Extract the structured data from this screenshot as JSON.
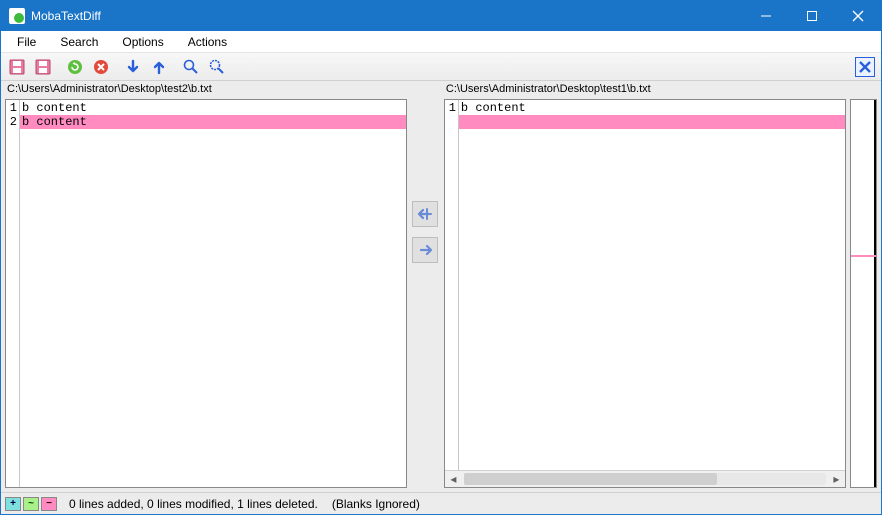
{
  "window": {
    "title": "MobaTextDiff"
  },
  "menu": {
    "file": "File",
    "search": "Search",
    "options": "Options",
    "actions": "Actions"
  },
  "toolbar_icons": {
    "save_left": "save-left-icon",
    "save_right": "save-right-icon",
    "reload": "reload-icon",
    "cancel": "cancel-icon",
    "next_diff": "arrow-down-icon",
    "prev_diff": "arrow-up-icon",
    "zoom": "zoom-icon",
    "zoom_reset": "zoom-reset-icon",
    "close_panel": "close-panel-icon"
  },
  "colors": {
    "titlebar": "#1a74c7",
    "deleted_bg": "#ff8bc0",
    "added_bg": "#7fe0e0",
    "modified_bg": "#a8f08a"
  },
  "left": {
    "path": "C:\\Users\\Administrator\\Desktop\\test2\\b.txt",
    "lines": [
      {
        "num": "1",
        "text": "b content",
        "kind": "same"
      },
      {
        "num": "2",
        "text": "b content",
        "kind": "deleted"
      }
    ]
  },
  "right": {
    "path": "C:\\Users\\Administrator\\Desktop\\test1\\b.txt",
    "lines": [
      {
        "num": "1",
        "text": "b content",
        "kind": "same"
      },
      {
        "num": "",
        "text": "",
        "kind": "deleted"
      }
    ]
  },
  "overview": {
    "markers": [
      {
        "top_pct": 40,
        "color": "#ff8bc0"
      }
    ]
  },
  "status": {
    "add_glyph": "+",
    "mod_glyph": "~",
    "del_glyph": "−",
    "summary": "0 lines added, 0 lines modified, 1 lines deleted.",
    "options": "(Blanks Ignored)"
  }
}
